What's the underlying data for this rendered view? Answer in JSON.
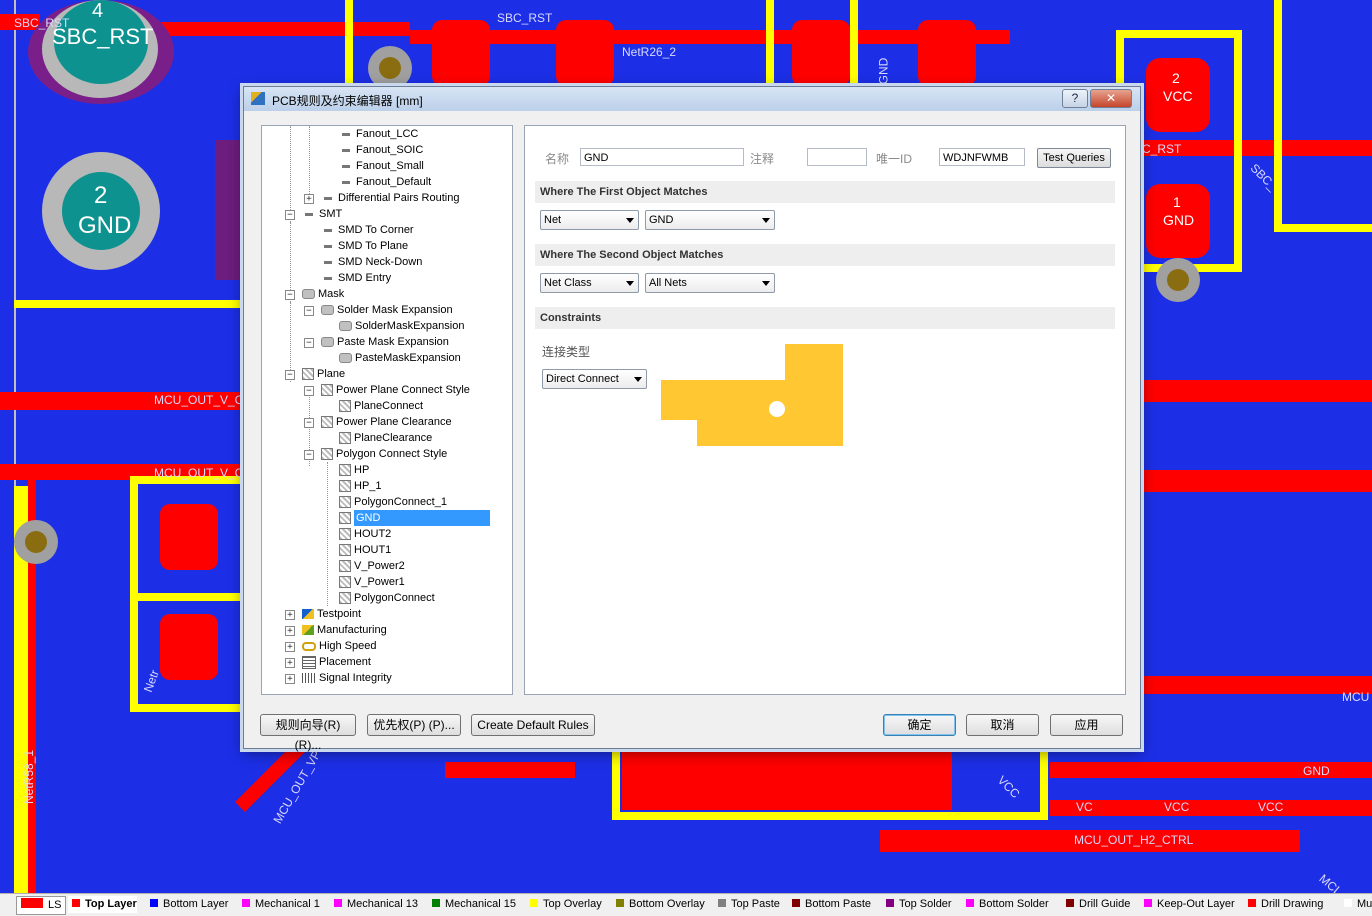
{
  "pcb": {
    "labels": [
      "SBC_RST",
      "SBC_RST",
      "NetR26_2",
      "GND",
      "VCC",
      "C_RST",
      "SBC_",
      "MCU_OUT_V_C",
      "MCU_OUT_V_C",
      "NetR58_1",
      "MCU_OUT_VP",
      "MCU_OUT_H2_CTRL",
      "GND",
      "VCC",
      "VCC",
      "VC",
      "MCU",
      "MCL",
      "Netr"
    ],
    "pads": [
      {
        "num": "4",
        "name": "SBC_RST"
      },
      {
        "num": "2",
        "name": "GND"
      },
      {
        "num": "2",
        "name": "VCC"
      },
      {
        "num": "1",
        "name": "GND"
      }
    ]
  },
  "dialog": {
    "title": "PCB规则及约束编辑器 [mm]",
    "help_label": "?",
    "close_label": "✕",
    "tree": [
      {
        "label": "Fanout_LCC",
        "icon": "fanout-icon"
      },
      {
        "label": "Fanout_SOIC",
        "icon": "fanout-icon"
      },
      {
        "label": "Fanout_Small",
        "icon": "fanout-icon"
      },
      {
        "label": "Fanout_Default",
        "icon": "fanout-icon"
      },
      {
        "label": "Differential Pairs Routing",
        "icon": "diffpair-icon"
      },
      {
        "label": "SMT",
        "icon": "smt-icon"
      },
      {
        "label": "SMD To Corner",
        "icon": "smt-icon"
      },
      {
        "label": "SMD To Plane",
        "icon": "smt-icon"
      },
      {
        "label": "SMD Neck-Down",
        "icon": "smt-icon"
      },
      {
        "label": "SMD Entry",
        "icon": "smt-icon"
      },
      {
        "label": "Mask",
        "icon": "mask-icon"
      },
      {
        "label": "Solder Mask Expansion",
        "icon": "mask-icon"
      },
      {
        "label": "SolderMaskExpansion",
        "icon": "mask-icon"
      },
      {
        "label": "Paste Mask Expansion",
        "icon": "mask-icon"
      },
      {
        "label": "PasteMaskExpansion",
        "icon": "mask-icon"
      },
      {
        "label": "Plane",
        "icon": "plane-icon"
      },
      {
        "label": "Power Plane Connect Style",
        "icon": "plane-icon"
      },
      {
        "label": "PlaneConnect",
        "icon": "plane-icon"
      },
      {
        "label": "Power Plane Clearance",
        "icon": "plane-icon"
      },
      {
        "label": "PlaneClearance",
        "icon": "plane-icon"
      },
      {
        "label": "Polygon Connect Style",
        "icon": "plane-icon"
      },
      {
        "label": "HP",
        "icon": "plane-icon"
      },
      {
        "label": "HP_1",
        "icon": "plane-icon"
      },
      {
        "label": "PolygonConnect_1",
        "icon": "plane-icon"
      },
      {
        "label": "GND",
        "icon": "plane-icon",
        "selected": true
      },
      {
        "label": "HOUT2",
        "icon": "plane-icon"
      },
      {
        "label": "HOUT1",
        "icon": "plane-icon"
      },
      {
        "label": "V_Power2",
        "icon": "plane-icon"
      },
      {
        "label": "V_Power1",
        "icon": "plane-icon"
      },
      {
        "label": "PolygonConnect",
        "icon": "plane-icon"
      },
      {
        "label": "Testpoint",
        "icon": "testpoint-icon"
      },
      {
        "label": "Manufacturing",
        "icon": "manufacturing-icon"
      },
      {
        "label": "High Speed",
        "icon": "highspeed-icon"
      },
      {
        "label": "Placement",
        "icon": "placement-icon"
      },
      {
        "label": "Signal Integrity",
        "icon": "signal-integrity-icon"
      }
    ],
    "rule": {
      "name_label": "名称",
      "name_value": "GND",
      "comment_label": "注释",
      "comment_value": "",
      "uid_label": "唯一ID",
      "uid_value": "WDJNFWMB",
      "test_queries_label": "Test Queries",
      "first_section": "Where The First Object Matches",
      "first_type": "Net",
      "first_value": "GND",
      "second_section": "Where The Second Object Matches",
      "second_type": "Net Class",
      "second_value": "All Nets",
      "constraints_section": "Constraints",
      "connect_type_label": "连接类型",
      "connect_type_value": "Direct Connect"
    },
    "buttons": {
      "rule_wizard": "规则向导(R) (R)...",
      "priorities": "优先权(P) (P)...",
      "create_default": "Create Default Rules",
      "ok": "确定",
      "cancel": "取消",
      "apply": "应用"
    }
  },
  "statusbar": {
    "ls_label": "LS",
    "layers": [
      {
        "name": "Top Layer",
        "color": "#ff0000",
        "active": true
      },
      {
        "name": "Bottom Layer",
        "color": "#0000ff"
      },
      {
        "name": "Mechanical 1",
        "color": "#ff00ff"
      },
      {
        "name": "Mechanical 13",
        "color": "#ff00ff"
      },
      {
        "name": "Mechanical 15",
        "color": "#008000"
      },
      {
        "name": "Top Overlay",
        "color": "#ffff00"
      },
      {
        "name": "Bottom Overlay",
        "color": "#808000"
      },
      {
        "name": "Top Paste",
        "color": "#808080"
      },
      {
        "name": "Bottom Paste",
        "color": "#800000"
      },
      {
        "name": "Top Solder",
        "color": "#800080"
      },
      {
        "name": "Bottom Solder",
        "color": "#ff00ff"
      },
      {
        "name": "Drill Guide",
        "color": "#800000"
      },
      {
        "name": "Keep-Out Layer",
        "color": "#ff00ff"
      },
      {
        "name": "Drill Drawing",
        "color": "#ff0000"
      },
      {
        "name": "Mu",
        "color": "#ffffff"
      }
    ]
  }
}
